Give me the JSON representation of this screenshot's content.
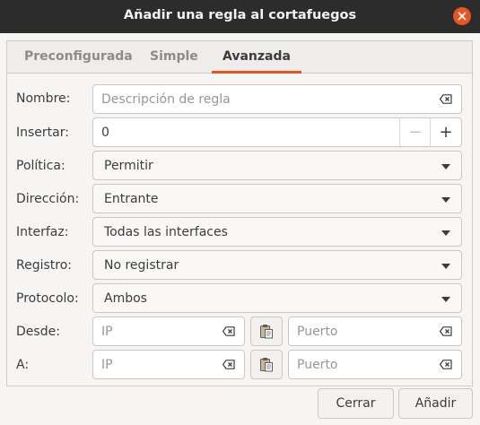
{
  "window": {
    "title": "Añadir una regla al cortafuegos"
  },
  "tabs": [
    {
      "label": "Preconfigurada"
    },
    {
      "label": "Simple"
    },
    {
      "label": "Avanzada"
    }
  ],
  "form": {
    "nombre": {
      "label": "Nombre:",
      "placeholder": "Descripción de regla"
    },
    "insertar": {
      "label": "Insertar:",
      "value": "0",
      "minus": "−",
      "plus": "+"
    },
    "politica": {
      "label": "Política:",
      "value": "Permitir"
    },
    "direccion": {
      "label": "Dirección:",
      "value": "Entrante"
    },
    "interfaz": {
      "label": "Interfaz:",
      "value": "Todas las interfaces"
    },
    "registro": {
      "label": "Registro:",
      "value": "No registrar"
    },
    "protocolo": {
      "label": "Protocolo:",
      "value": "Ambos"
    },
    "desde": {
      "label": "Desde:",
      "ip_placeholder": "IP",
      "port_placeholder": "Puerto"
    },
    "a": {
      "label": "A:",
      "ip_placeholder": "IP",
      "port_placeholder": "Puerto"
    }
  },
  "buttons": {
    "cancel": "Cerrar",
    "add": "Añadir"
  },
  "icons": {
    "close": "close-icon",
    "clear": "clear-text-icon",
    "paste": "paste-icon",
    "dropdown": "chevron-down-icon"
  },
  "colors": {
    "accent": "#e95420",
    "titlebar": "#2c2c2c"
  }
}
